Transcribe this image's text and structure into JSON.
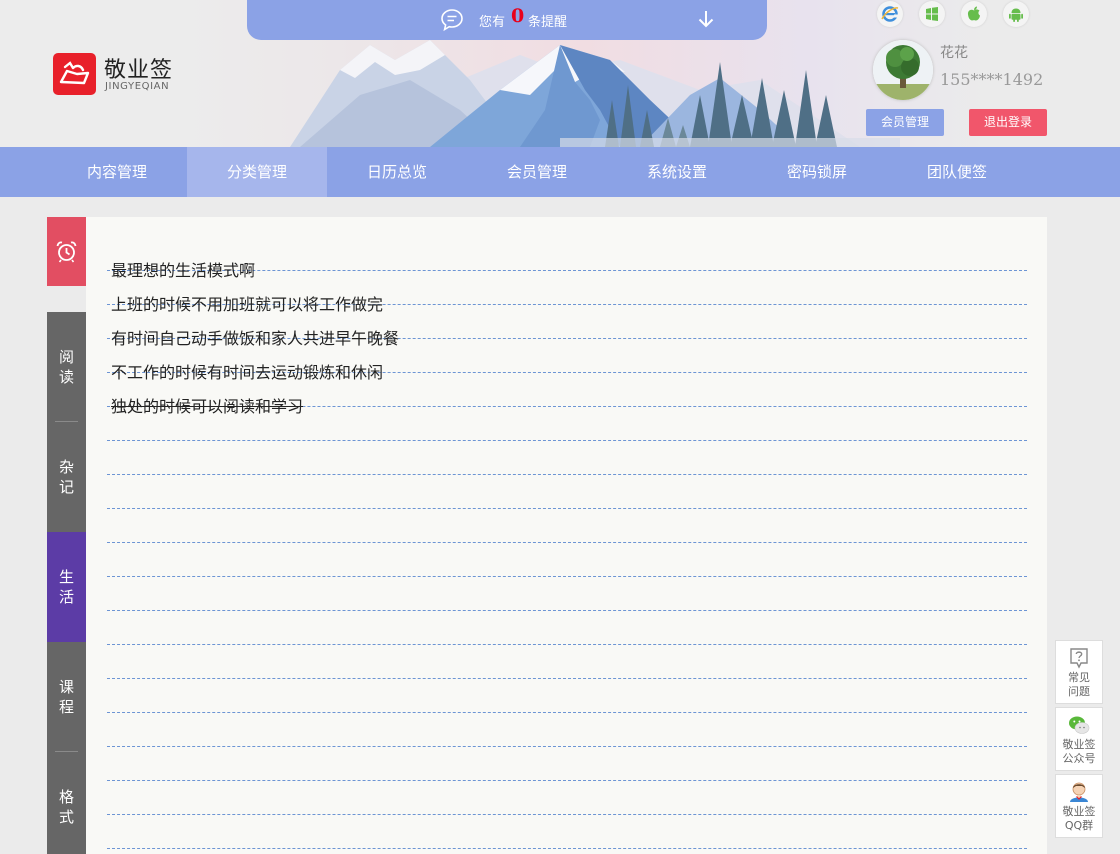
{
  "brand": {
    "name": "敬业签",
    "sub": "JINGYEQIAN"
  },
  "reminder": {
    "prefix": "您有",
    "count": "0",
    "suffix": "条提醒"
  },
  "platforms": [
    "ie-icon",
    "windows-icon",
    "apple-icon",
    "android-icon"
  ],
  "user": {
    "name": "花花",
    "phone": "155****1492",
    "member_btn": "会员管理",
    "logout_btn": "退出登录"
  },
  "nav": [
    "内容管理",
    "分类管理",
    "日历总览",
    "会员管理",
    "系统设置",
    "密码锁屏",
    "团队便签"
  ],
  "nav_active": "分类管理",
  "categories": [
    {
      "label": "阅读",
      "c1": "阅",
      "c2": "读"
    },
    {
      "label": "杂记",
      "c1": "杂",
      "c2": "记"
    },
    {
      "label": "生活",
      "c1": "生",
      "c2": "活"
    },
    {
      "label": "课程",
      "c1": "课",
      "c2": "程"
    },
    {
      "label": "格式",
      "c1": "格",
      "c2": "式"
    }
  ],
  "active_category": "生活",
  "notes": [
    {
      "text": "最理想的生活模式啊",
      "done": false
    },
    {
      "text": "上班的时候不用加班就可以将工作做完",
      "done": false
    },
    {
      "text": "有时间自己动手做饭和家人共进早午晚餐",
      "done": false
    },
    {
      "text": "不工作的时候有时间去运动锻炼和休闲",
      "done": false
    },
    {
      "text": "独处的时候可以阅读和学习",
      "done": true
    }
  ],
  "widgets": [
    {
      "l1": "常见",
      "l2": "问题",
      "icon": "help-icon"
    },
    {
      "l1": "敬业签",
      "l2": "公众号",
      "icon": "wechat-icon"
    },
    {
      "l1": "敬业签",
      "l2": "QQ群",
      "icon": "qq-icon"
    }
  ],
  "colors": {
    "accent": "#8ba2e6",
    "alarm": "#e24e62",
    "logout": "#f1566b",
    "active_tab": "#5c3ca6",
    "tab": "#666666",
    "rule": "#6d95d4"
  }
}
